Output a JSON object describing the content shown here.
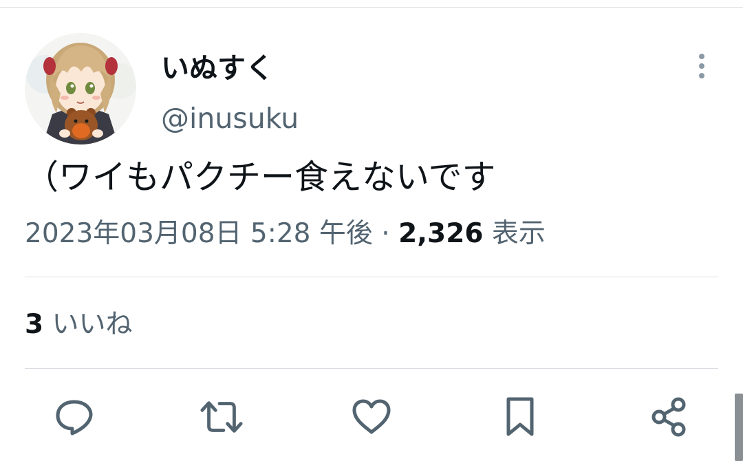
{
  "tweet": {
    "author": {
      "display_name": "いぬすく",
      "handle": "@inusuku",
      "avatar": "anime-girl-holding-bear-avatar"
    },
    "text": "（ワイもパクチー食えないです",
    "timestamp": "2023年03月08日 5:28 午後",
    "separator": "·",
    "views_count": "2,326",
    "views_label": "表示",
    "likes_count": "3",
    "likes_label": "いいね"
  },
  "icons": {
    "more": "more-vertical-icon",
    "reply": "reply-icon",
    "retweet": "retweet-icon",
    "like": "heart-icon",
    "bookmark": "bookmark-icon",
    "share": "share-icon"
  },
  "colors": {
    "text_primary": "#0f1419",
    "text_secondary": "#536471",
    "divider": "#d9dde1"
  }
}
